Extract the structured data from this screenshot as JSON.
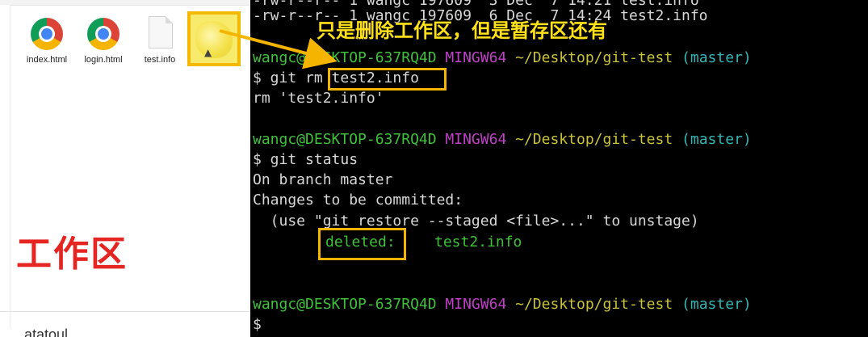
{
  "explorer": {
    "files": [
      {
        "name": "index.html",
        "icon": "chrome-icon"
      },
      {
        "name": "login.html",
        "icon": "chrome-icon"
      },
      {
        "name": "test.info",
        "icon": "text-file-icon"
      }
    ],
    "highlighted_file_icon": "image-file-icon",
    "work_area_label": "工作区",
    "bottom_text": "atatoul"
  },
  "annotation": {
    "text": "只是删除工作区，但是暂存区还有",
    "color": "#ffe11a",
    "box_color": "#f5b400"
  },
  "terminal": {
    "top_partial_1": "-rw-r--r-- 1 wangc 197609  3 Dec  7 14:21 test.info",
    "top_partial_2": "-rw-r--r-- 1 wangc 197609  6 Dec  7 14:24 test2.info",
    "prompt_user": "wangc@DESKTOP-637RQ4D",
    "prompt_env": "MINGW64",
    "prompt_path": "~/Desktop/git-test",
    "prompt_branch": "(master)",
    "cmd1_prefix": "$ git rm ",
    "cmd1_arg": "test2.info",
    "out1": "rm 'test2.info'",
    "cmd2": "$ git status",
    "out2_line1": "On branch master",
    "out2_line2": "Changes to be committed:",
    "out2_line3": "  (use \"git restore --staged <file>...\" to unstage)",
    "deleted_label": "deleted:",
    "deleted_file": "test2.info",
    "final_prompt": "$",
    "colors": {
      "user": "#3fc23a",
      "env": "#c040c8",
      "path": "#c9c23a",
      "branch": "#32b7b7",
      "text": "#d7d7d7"
    }
  }
}
